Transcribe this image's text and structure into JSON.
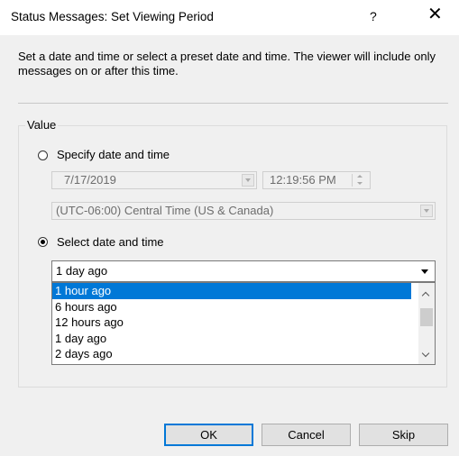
{
  "window": {
    "title": "Status Messages: Set Viewing Period",
    "help_glyph": "?",
    "close_glyph": "✕"
  },
  "instructions": "Set a date and time or select a preset date and time. The viewer will include only messages on or after this time.",
  "value_group": {
    "legend": "Value",
    "specify": {
      "label": "Specify date and time",
      "checked": false,
      "date": "7/17/2019",
      "time": "12:19:56 PM",
      "timezone": "(UTC-06:00) Central Time (US & Canada)"
    },
    "select": {
      "label": "Select date and time",
      "checked": true,
      "current_value": "1 day ago",
      "options": [
        "1 hour ago",
        "6 hours ago",
        "12 hours ago",
        "1 day ago",
        "2 days ago"
      ],
      "highlighted": "1 hour ago"
    }
  },
  "buttons": {
    "ok": "OK",
    "cancel": "Cancel",
    "skip": "Skip"
  },
  "colors": {
    "accent": "#0078d7",
    "disabled_text": "#6d6d6d"
  }
}
